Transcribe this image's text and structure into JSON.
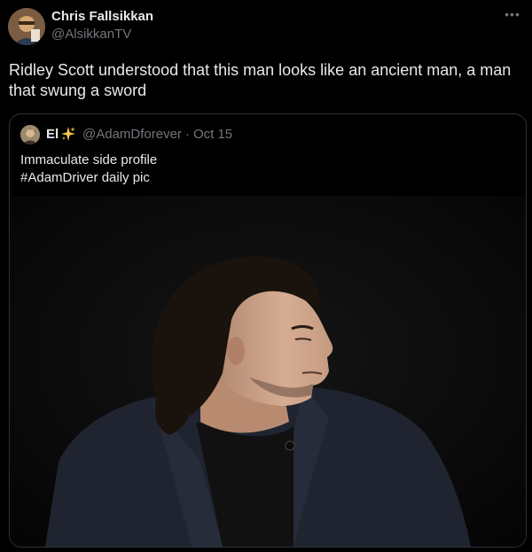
{
  "author": {
    "display_name": "Chris Fallsikkan",
    "handle": "@AlsikkanTV"
  },
  "menu": {
    "more_icon": "more-horizontal-icon"
  },
  "tweet": {
    "text": "Ridley Scott understood that this man looks like an ancient man, a man that swung a sword"
  },
  "quote": {
    "display_name": "El",
    "badge_icon": "sparkle-icon",
    "handle": "@AdamDforever",
    "separator": "·",
    "date": "Oct 15",
    "text_line_1": "Immaculate side profile",
    "text_line_2": "#AdamDriver daily pic"
  },
  "colors": {
    "background": "#000000",
    "text_primary": "#e7e9ea",
    "text_secondary": "#71767b",
    "border": "#2f3336",
    "sparkle": "#f7c94a"
  }
}
